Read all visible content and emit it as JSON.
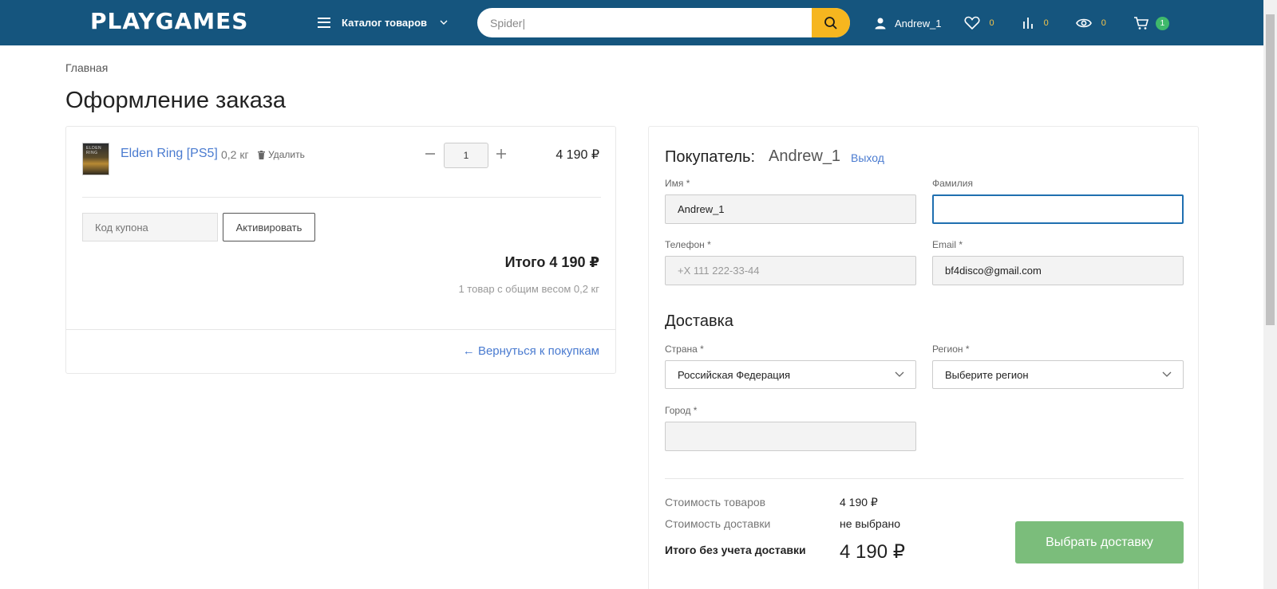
{
  "header": {
    "logo": "PLAYGAMES",
    "catalog_label": "Каталог товаров",
    "search_value": "Spider|",
    "user_name": "Andrew_1",
    "favorites_count": "0",
    "compare_count": "0",
    "viewed_count": "0",
    "cart_count": "1",
    "accent_color": "#f6b61f",
    "header_color": "#15557e",
    "icons": [
      "menu-icon",
      "chevron-down-icon",
      "search-icon",
      "user-icon",
      "heart-icon",
      "bar-chart-icon",
      "eye-icon",
      "cart-icon"
    ]
  },
  "breadcrumb": "Главная",
  "page_title": "Оформление заказа",
  "cart": {
    "product_name": "Elden Ring [PS5]",
    "product_cover_text": "ELDEN RING",
    "product_weight": "0,2 кг",
    "delete_label": "Удалить",
    "quantity": "1",
    "price": "4 190 ₽",
    "coupon_placeholder": "Код купона",
    "activate_label": "Активировать",
    "total": "Итого 4 190 ₽",
    "total_sub": "1 товар с общим весом 0,2 кг",
    "back_link": "← Вернуться к покупкам"
  },
  "buyer": {
    "label": "Покупатель:",
    "name": "Andrew_1",
    "logout": "Выход",
    "first_name_label": "Имя *",
    "first_name_value": "Andrew_1",
    "last_name_label": "Фамилия",
    "last_name_value": "",
    "phone_label": "Телефон *",
    "phone_placeholder": "+X 111 222-33-44",
    "email_label": "Email *",
    "email_value": "bf4disco@gmail.com"
  },
  "delivery": {
    "heading": "Доставка",
    "country_label": "Страна *",
    "country_value": "Российская Федерация",
    "region_label": "Регион *",
    "region_value": "Выберите регион",
    "city_label": "Город *",
    "city_value": ""
  },
  "summary": {
    "goods_label": "Стоимость товаров",
    "goods_value": "4 190 ₽",
    "shipping_label": "Стоимость доставки",
    "shipping_value": "не выбрано",
    "total_label": "Итого без учета доставки",
    "total_value": "4 190 ₽",
    "choose_button": "Выбрать доставку",
    "button_color": "#7bbd7b"
  }
}
